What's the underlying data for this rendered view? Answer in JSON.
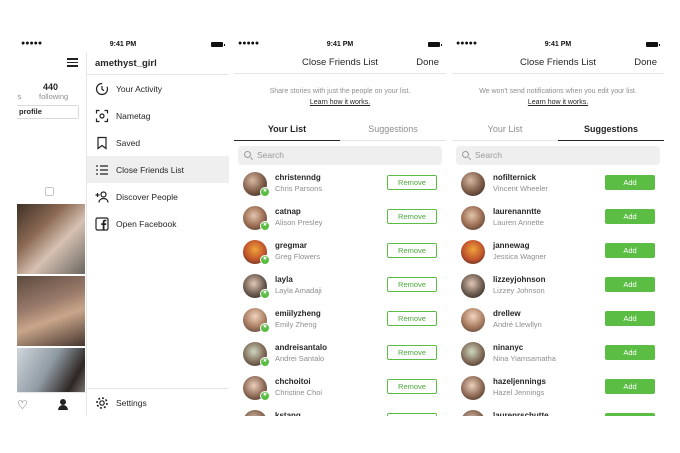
{
  "status": {
    "time": "9:41 PM",
    "signal": "●●●●●"
  },
  "phone1": {
    "following_count": "440",
    "following_label": "following",
    "partial_label": "rs",
    "edit_profile": "profile",
    "username": "amethyst_girl",
    "menu_items": [
      {
        "label": "Your Activity",
        "icon": "activity-icon"
      },
      {
        "label": "Nametag",
        "icon": "nametag-icon"
      },
      {
        "label": "Saved",
        "icon": "bookmark-icon"
      },
      {
        "label": "Close Friends List",
        "icon": "list-icon"
      },
      {
        "label": "Discover People",
        "icon": "add-person-icon"
      },
      {
        "label": "Open Facebook",
        "icon": "facebook-icon"
      }
    ],
    "settings": "Settings"
  },
  "phone2": {
    "title": "Close Friends List",
    "done": "Done",
    "description": "Share stories with just the people on your list.",
    "link": "Learn how it works.",
    "tab_left": "Your List",
    "tab_right": "Suggestions",
    "search_placeholder": "Search",
    "action_label": "Remove",
    "rows": [
      {
        "username": "christenndg",
        "name": "Chris Parsons"
      },
      {
        "username": "catnap",
        "name": "Alison Presley"
      },
      {
        "username": "gregmar",
        "name": "Greg Flowers"
      },
      {
        "username": "layla",
        "name": "Layla Amadaji"
      },
      {
        "username": "emiilyzheng",
        "name": "Emily Zheng"
      },
      {
        "username": "andreisantalo",
        "name": "Andrei Santalo"
      },
      {
        "username": "chchoitoi",
        "name": "Christine Choi"
      },
      {
        "username": "kstang",
        "name": ""
      }
    ]
  },
  "phone3": {
    "title": "Close Friends List",
    "done": "Done",
    "description": "We won't send notifications when you edit your list.",
    "link": "Learn how it works.",
    "tab_left": "Your List",
    "tab_right": "Suggestions",
    "search_placeholder": "Search",
    "action_label": "Add",
    "rows": [
      {
        "username": "nofilternick",
        "name": "Vincent Wheeler"
      },
      {
        "username": "laurenanntte",
        "name": "Lauren Annette"
      },
      {
        "username": "jannewag",
        "name": "Jessica Wagner"
      },
      {
        "username": "lizzeyjohnson",
        "name": "Lizzey Johnson"
      },
      {
        "username": "drellew",
        "name": "André Llewllyn"
      },
      {
        "username": "ninanyc",
        "name": "Nina Yiamsamatha"
      },
      {
        "username": "hazeljennings",
        "name": "Hazel Jennings"
      },
      {
        "username": "laurenrschutte",
        "name": ""
      }
    ]
  },
  "colors": {
    "accent_green": "#5bbd44",
    "text": "#262626",
    "muted": "#8e8e8e"
  }
}
